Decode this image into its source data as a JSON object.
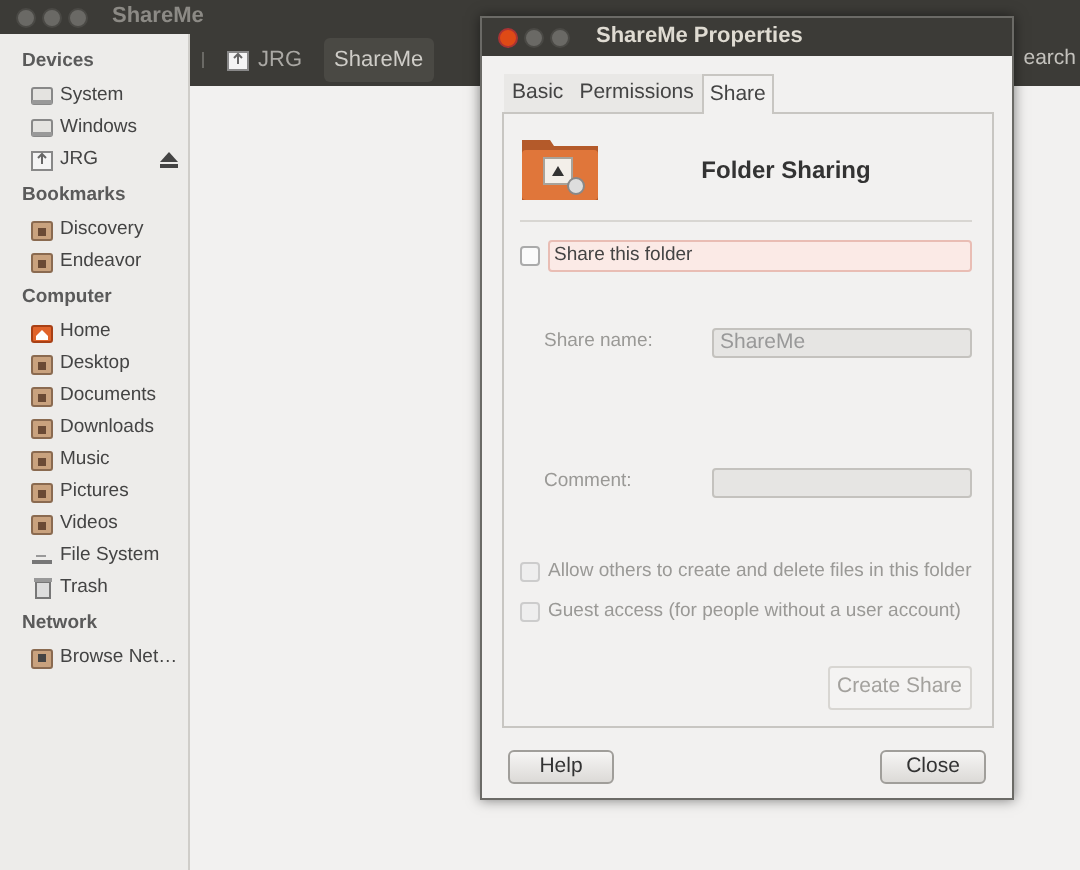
{
  "window": {
    "title": "ShareMe"
  },
  "sidebar": {
    "sections": [
      {
        "heading": "Devices",
        "items": [
          {
            "label": "System",
            "kind": "drive",
            "ejectable": false
          },
          {
            "label": "Windows",
            "kind": "drive",
            "ejectable": false
          },
          {
            "label": "JRG",
            "kind": "usb",
            "ejectable": true
          }
        ]
      },
      {
        "heading": "Bookmarks",
        "items": [
          {
            "label": "Discovery",
            "kind": "folder",
            "ejectable": false
          },
          {
            "label": "Endeavor",
            "kind": "folder",
            "ejectable": false
          }
        ]
      },
      {
        "heading": "Computer",
        "items": [
          {
            "label": "Home",
            "kind": "home",
            "ejectable": false
          },
          {
            "label": "Desktop",
            "kind": "folder",
            "ejectable": false
          },
          {
            "label": "Documents",
            "kind": "folder",
            "ejectable": false
          },
          {
            "label": "Downloads",
            "kind": "folder",
            "ejectable": false
          },
          {
            "label": "Music",
            "kind": "folder",
            "ejectable": false
          },
          {
            "label": "Pictures",
            "kind": "folder",
            "ejectable": false
          },
          {
            "label": "Videos",
            "kind": "folder",
            "ejectable": false
          },
          {
            "label": "File System",
            "kind": "filesystem",
            "ejectable": false
          },
          {
            "label": "Trash",
            "kind": "trash",
            "ejectable": false
          }
        ]
      },
      {
        "heading": "Network",
        "items": [
          {
            "label": "Browse Net…",
            "kind": "network",
            "ejectable": false
          }
        ]
      }
    ]
  },
  "breadcrumbs": [
    {
      "label": "JRG",
      "kind": "usb",
      "selected": false
    },
    {
      "label": "ShareMe",
      "selected": true
    }
  ],
  "search": {
    "label": "earch"
  },
  "dialog": {
    "title": "ShareMe Properties",
    "tabs": [
      {
        "label": "Basic",
        "selected": false
      },
      {
        "label": "Permissions",
        "selected": false
      },
      {
        "label": "Share",
        "selected": true
      }
    ],
    "heading": "Folder Sharing",
    "share_checkbox": {
      "label": "Share this folder",
      "checked": false
    },
    "fields": [
      {
        "label": "Share name:",
        "value": "ShareMe",
        "disabled": true
      },
      {
        "label": "Comment:",
        "disabled": true
      }
    ],
    "options": [
      {
        "label": "Allow others to create and delete files in this folder",
        "checked": false,
        "disabled": true
      },
      {
        "label": "Guest access (for people without a user account)",
        "checked": false,
        "disabled": true
      }
    ],
    "create_button": {
      "label": "Create Share",
      "disabled": true
    },
    "buttons": [
      "Help",
      "Close"
    ]
  }
}
